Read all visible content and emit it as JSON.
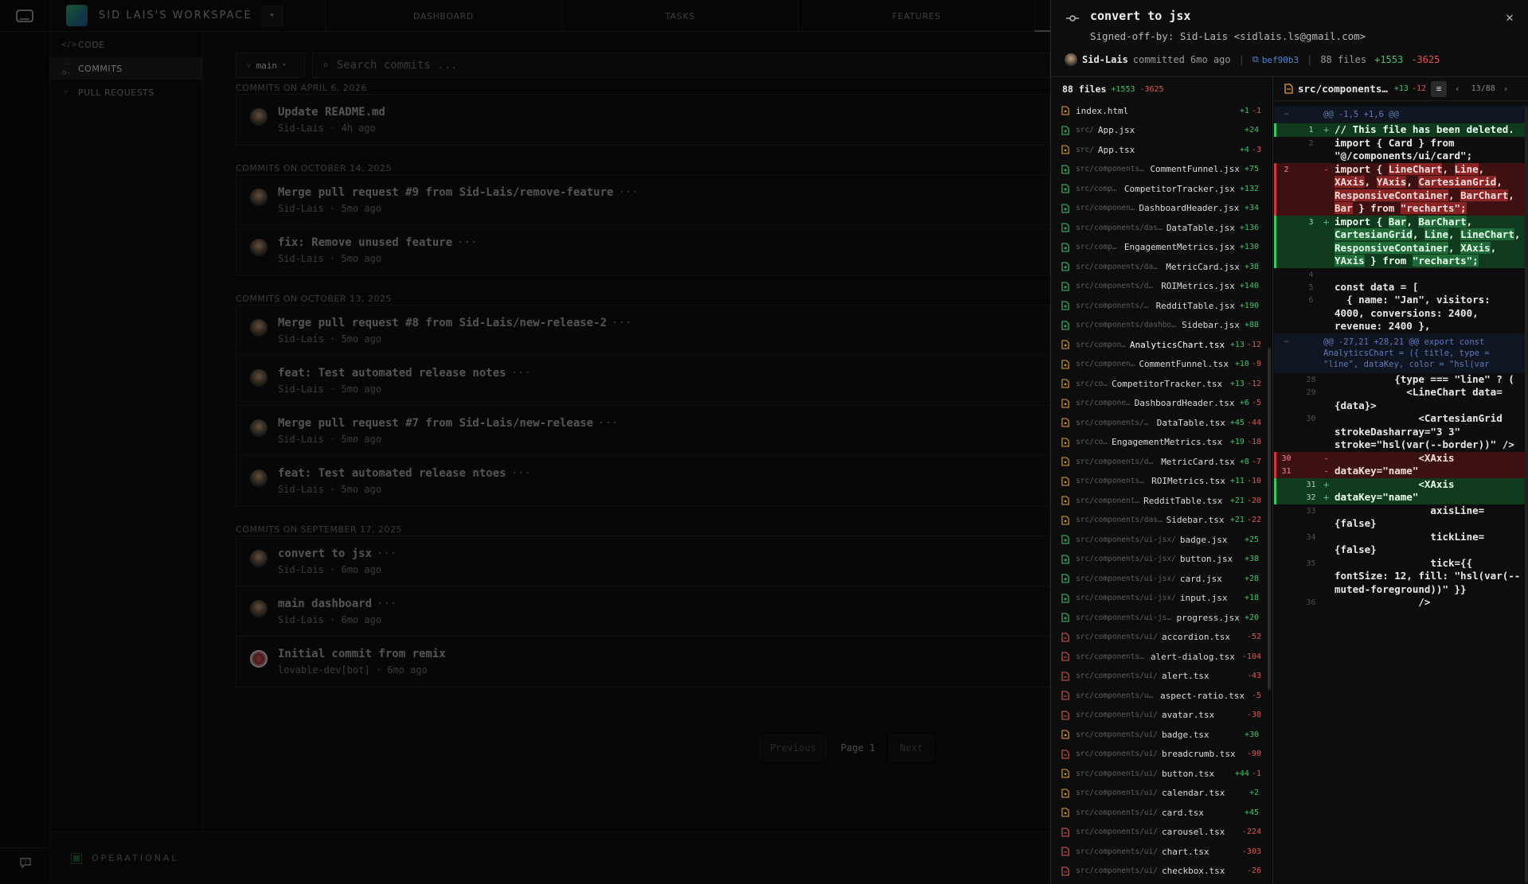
{
  "workspace": {
    "name": "SID LAIS'S WORKSPACE"
  },
  "nav_tabs": [
    "DASHBOARD",
    "TASKS",
    "FEATURES",
    ""
  ],
  "subnav": [
    {
      "label": "CODE",
      "icon": "code-icon"
    },
    {
      "label": "COMMITS",
      "icon": "commit-icon",
      "active": true
    },
    {
      "label": "PULL REQUESTS",
      "icon": "pull-request-icon"
    }
  ],
  "branch": "main",
  "search": {
    "placeholder": "Search commits ..."
  },
  "groups": [
    {
      "title": "COMMITS ON APRIL 6, 2026",
      "commits": [
        {
          "title": "Update README.md",
          "more": false,
          "author": "Sid-Lais",
          "time": "4h ago"
        }
      ]
    },
    {
      "title": "COMMITS ON OCTOBER 14, 2025",
      "commits": [
        {
          "title": "Merge pull request #9 from Sid-Lais/remove-feature",
          "more": true,
          "author": "Sid-Lais",
          "time": "5mo ago"
        },
        {
          "title": "fix: Remove unused feature",
          "more": true,
          "author": "Sid-Lais",
          "time": "5mo ago"
        }
      ]
    },
    {
      "title": "COMMITS ON OCTOBER 13, 2025",
      "commits": [
        {
          "title": "Merge pull request #8 from Sid-Lais/new-release-2",
          "more": true,
          "author": "Sid-Lais",
          "time": "5mo ago"
        },
        {
          "title": "feat: Test automated release notes",
          "more": true,
          "author": "Sid-Lais",
          "time": "5mo ago"
        },
        {
          "title": "Merge pull request #7 from Sid-Lais/new-release",
          "more": true,
          "author": "Sid-Lais",
          "time": "5mo ago"
        },
        {
          "title": "feat: Test automated release ntoes",
          "more": true,
          "author": "Sid-Lais",
          "time": "5mo ago"
        }
      ]
    },
    {
      "title": "COMMITS ON SEPTEMBER 17, 2025",
      "commits": [
        {
          "title": "convert to jsx",
          "more": true,
          "author": "Sid-Lais",
          "time": "6mo ago"
        },
        {
          "title": "main dashboard",
          "more": true,
          "author": "Sid-Lais",
          "time": "6mo ago"
        },
        {
          "title": "Initial commit from remix",
          "more": false,
          "author": "lovable-dev[bot]",
          "time": "6mo ago",
          "bot": true
        }
      ]
    }
  ],
  "pager": {
    "prev": "Previous",
    "page": "Page 1",
    "next": "Next"
  },
  "status": {
    "label": "OPERATIONAL",
    "color": "#1c5a32"
  },
  "drawer": {
    "title": "convert to jsx",
    "signoff": "Signed-off-by: Sid-Lais <sidlais.ls@gmail.com>",
    "author": "Sid-Lais",
    "committed": "committed 6mo ago",
    "sha": "bef90b3",
    "files_count": "88 files",
    "additions": "+1553",
    "deletions": "-3625",
    "colors": {
      "add": "#3ec46d",
      "del": "#e05555",
      "sha": "#4a8ad8"
    }
  },
  "file_list_header": {
    "count": "88 files",
    "add": "+1553",
    "del": "-3625"
  },
  "files": [
    {
      "dir": "",
      "name": "index.html",
      "add": "+1",
      "del": "-1",
      "kind": "mod"
    },
    {
      "dir": "src/",
      "name": "App.jsx",
      "add": "+24",
      "del": "",
      "kind": "add"
    },
    {
      "dir": "src/",
      "name": "App.tsx",
      "add": "+4",
      "del": "-3",
      "kind": "mod"
    },
    {
      "dir": "src/components/…",
      "name": "CommentFunnel.jsx",
      "add": "+75",
      "del": "",
      "kind": "add"
    },
    {
      "dir": "src/compo…",
      "name": "CompetitorTracker.jsx",
      "add": "+132",
      "del": "",
      "kind": "add"
    },
    {
      "dir": "src/componen…",
      "name": "DashboardHeader.jsx",
      "add": "+34",
      "del": "",
      "kind": "add"
    },
    {
      "dir": "src/components/dash…",
      "name": "DataTable.jsx",
      "add": "+136",
      "del": "",
      "kind": "add"
    },
    {
      "dir": "src/compo…",
      "name": "EngagementMetrics.jsx",
      "add": "+130",
      "del": "",
      "kind": "add"
    },
    {
      "dir": "src/components/dash…",
      "name": "MetricCard.jsx",
      "add": "+38",
      "del": "",
      "kind": "add"
    },
    {
      "dir": "src/components/da…",
      "name": "ROIMetrics.jsx",
      "add": "+140",
      "del": "",
      "kind": "add"
    },
    {
      "dir": "src/components/d…",
      "name": "RedditTable.jsx",
      "add": "+190",
      "del": "",
      "kind": "add"
    },
    {
      "dir": "src/components/dashboa…",
      "name": "Sidebar.jsx",
      "add": "+88",
      "del": "",
      "kind": "add"
    },
    {
      "dir": "src/compon…",
      "name": "AnalyticsChart.tsx",
      "add": "+13",
      "del": "-12",
      "kind": "mod",
      "active": true
    },
    {
      "dir": "src/componen…",
      "name": "CommentFunnel.tsx",
      "add": "+10",
      "del": "-9",
      "kind": "mod"
    },
    {
      "dir": "src/co…",
      "name": "CompetitorTracker.tsx",
      "add": "+13",
      "del": "-12",
      "kind": "mod"
    },
    {
      "dir": "src/compone…",
      "name": "DashboardHeader.tsx",
      "add": "+6",
      "del": "-5",
      "kind": "mod"
    },
    {
      "dir": "src/components/d…",
      "name": "DataTable.tsx",
      "add": "+45",
      "del": "-44",
      "kind": "mod"
    },
    {
      "dir": "src/co…",
      "name": "EngagementMetrics.tsx",
      "add": "+19",
      "del": "-18",
      "kind": "mod"
    },
    {
      "dir": "src/components/da…",
      "name": "MetricCard.tsx",
      "add": "+8",
      "del": "-7",
      "kind": "mod"
    },
    {
      "dir": "src/components/…",
      "name": "ROIMetrics.tsx",
      "add": "+11",
      "del": "-10",
      "kind": "mod"
    },
    {
      "dir": "src/component…",
      "name": "RedditTable.tsx",
      "add": "+21",
      "del": "-20",
      "kind": "mod"
    },
    {
      "dir": "src/components/das…",
      "name": "Sidebar.tsx",
      "add": "+21",
      "del": "-22",
      "kind": "mod"
    },
    {
      "dir": "src/components/ui-jsx/",
      "name": "badge.jsx",
      "add": "+25",
      "del": "",
      "kind": "add"
    },
    {
      "dir": "src/components/ui-jsx/",
      "name": "button.jsx",
      "add": "+38",
      "del": "",
      "kind": "add"
    },
    {
      "dir": "src/components/ui-jsx/",
      "name": "card.jsx",
      "add": "+28",
      "del": "",
      "kind": "add"
    },
    {
      "dir": "src/components/ui-jsx/",
      "name": "input.jsx",
      "add": "+18",
      "del": "",
      "kind": "add"
    },
    {
      "dir": "src/components/ui-jsx/",
      "name": "progress.jsx",
      "add": "+20",
      "del": "",
      "kind": "add"
    },
    {
      "dir": "src/components/ui/",
      "name": "accordion.tsx",
      "add": "",
      "del": "-52",
      "kind": "del"
    },
    {
      "dir": "src/components/…",
      "name": "alert-dialog.tsx",
      "add": "",
      "del": "-104",
      "kind": "del"
    },
    {
      "dir": "src/components/ui/",
      "name": "alert.tsx",
      "add": "",
      "del": "-43",
      "kind": "del"
    },
    {
      "dir": "src/components/ui/",
      "name": "aspect-ratio.tsx",
      "add": "",
      "del": "-5",
      "kind": "del"
    },
    {
      "dir": "src/components/ui/",
      "name": "avatar.tsx",
      "add": "",
      "del": "-38",
      "kind": "del"
    },
    {
      "dir": "src/components/ui/",
      "name": "badge.tsx",
      "add": "+30",
      "del": "",
      "kind": "mod"
    },
    {
      "dir": "src/components/ui/",
      "name": "breadcrumb.tsx",
      "add": "",
      "del": "-90",
      "kind": "del"
    },
    {
      "dir": "src/components/ui/",
      "name": "button.tsx",
      "add": "+44",
      "del": "-1",
      "kind": "mod"
    },
    {
      "dir": "src/components/ui/",
      "name": "calendar.tsx",
      "add": "+2",
      "del": "",
      "kind": "mod"
    },
    {
      "dir": "src/components/ui/",
      "name": "card.tsx",
      "add": "+45",
      "del": "",
      "kind": "mod"
    },
    {
      "dir": "src/components/ui/",
      "name": "carousel.tsx",
      "add": "",
      "del": "-224",
      "kind": "del"
    },
    {
      "dir": "src/components/ui/",
      "name": "chart.tsx",
      "add": "",
      "del": "-303",
      "kind": "del"
    },
    {
      "dir": "src/components/ui/",
      "name": "checkbox.tsx",
      "add": "",
      "del": "-26",
      "kind": "del"
    }
  ],
  "diff_header": {
    "file": "src/components…",
    "add": "+13",
    "del": "-12",
    "counter": "13/88"
  },
  "diff_lines": [
    {
      "type": "hunk",
      "ln1": "…",
      "ln2": "",
      "text": "@@ -1,5 +1,6 @@"
    },
    {
      "type": "add",
      "ln1": "",
      "ln2": "1",
      "sign": "+",
      "text": "// This file has been deleted."
    },
    {
      "type": "ctx",
      "ln1": "",
      "ln2": "2",
      "sign": "",
      "text": "import { Card } from \"@/components/ui/card\";"
    },
    {
      "type": "del",
      "ln1": "2",
      "ln2": "",
      "sign": "-",
      "text": "import { LineChart, Line, XAxis, YAxis, CartesianGrid, ResponsiveContainer, BarChart, Bar } from \"recharts\";"
    },
    {
      "type": "add",
      "ln1": "",
      "ln2": "3",
      "sign": "+",
      "text": "import { Bar, BarChart, CartesianGrid, Line, LineChart, ResponsiveContainer, XAxis, YAxis } from \"recharts\";"
    },
    {
      "type": "ctx",
      "ln1": "",
      "ln2": "4",
      "sign": "",
      "text": ""
    },
    {
      "type": "ctx",
      "ln1": "",
      "ln2": "5",
      "sign": "",
      "text": "const data = ["
    },
    {
      "type": "ctx",
      "ln1": "",
      "ln2": "6",
      "sign": "",
      "text": "  { name: \"Jan\", visitors: 4000, conversions: 2400, revenue: 2400 },"
    },
    {
      "type": "hunk",
      "ln1": "…",
      "ln2": "",
      "text": "@@ -27,21 +28,21 @@ export const AnalyticsChart = ({ title, type = \"line\", dataKey, color = \"hsl(var"
    },
    {
      "type": "ctx",
      "ln1": "",
      "ln2": "28",
      "sign": "",
      "text": "          {type === \"line\" ? ("
    },
    {
      "type": "ctx",
      "ln1": "",
      "ln2": "29",
      "sign": "",
      "text": "            <LineChart data={data}>"
    },
    {
      "type": "ctx",
      "ln1": "",
      "ln2": "30",
      "sign": "",
      "text": "              <CartesianGrid strokeDasharray=\"3 3\" stroke=\"hsl(var(--border))\" />"
    },
    {
      "type": "del",
      "ln1": "30",
      "ln2": "",
      "sign": "-",
      "text": "              <XAxis"
    },
    {
      "type": "del",
      "ln1": "31",
      "ln2": "",
      "sign": "-",
      "text": "dataKey=\"name\""
    },
    {
      "type": "add",
      "ln1": "",
      "ln2": "31",
      "sign": "+",
      "text": "              <XAxis"
    },
    {
      "type": "add",
      "ln1": "",
      "ln2": "32",
      "sign": "+",
      "text": "dataKey=\"name\""
    },
    {
      "type": "ctx",
      "ln1": "",
      "ln2": "33",
      "sign": "",
      "text": "                axisLine={false}"
    },
    {
      "type": "ctx",
      "ln1": "",
      "ln2": "34",
      "sign": "",
      "text": "                tickLine={false}"
    },
    {
      "type": "ctx",
      "ln1": "",
      "ln2": "35",
      "sign": "",
      "text": "                tick={{ fontSize: 12, fill: \"hsl(var(--muted-foreground))\" }}"
    },
    {
      "type": "ctx",
      "ln1": "",
      "ln2": "36",
      "sign": "",
      "text": "              />"
    }
  ]
}
